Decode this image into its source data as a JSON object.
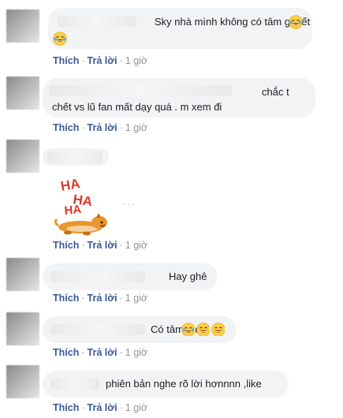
{
  "comments": [
    {
      "text": "Sky nhà mình không có tâm gì hết",
      "emoji_icons": [
        "tears-of-joy-emoji",
        "tears-of-joy-emoji"
      ],
      "actions": {
        "like": "Thích",
        "reply": "Trả lời",
        "time": "1 giờ"
      }
    },
    {
      "text_line1": "chắc t",
      "text_line2": "chết vs lũ fan mất dạy quá . m xem đi",
      "actions": {
        "like": "Thích",
        "reply": "Trả lời",
        "time": "1 giờ"
      }
    },
    {
      "sticker": "haha-dog-sticker",
      "sticker_text": "HA HA",
      "more": "···",
      "actions": {
        "like": "Thích",
        "reply": "Trả lời",
        "time": "1 giờ"
      }
    },
    {
      "text": "Hay ghê",
      "actions": {
        "like": "Thích",
        "reply": "Trả lời",
        "time": "1 giờ"
      }
    },
    {
      "text": "Có tâm tí đi",
      "emoji_icons": [
        "tears-of-joy-emoji",
        "grinning-emoji",
        "grinning-emoji"
      ],
      "actions": {
        "like": "Thích",
        "reply": "Trả lời",
        "time": "1 giờ"
      }
    },
    {
      "text": "phiên bản nghe rõ lời hơnnnn ,like",
      "actions": {
        "like": "Thích",
        "reply": "Trả lời",
        "time": "1 giờ"
      }
    }
  ],
  "colors": {
    "link": "#385898",
    "bubble": "#f2f3f5",
    "meta": "#90949c"
  }
}
